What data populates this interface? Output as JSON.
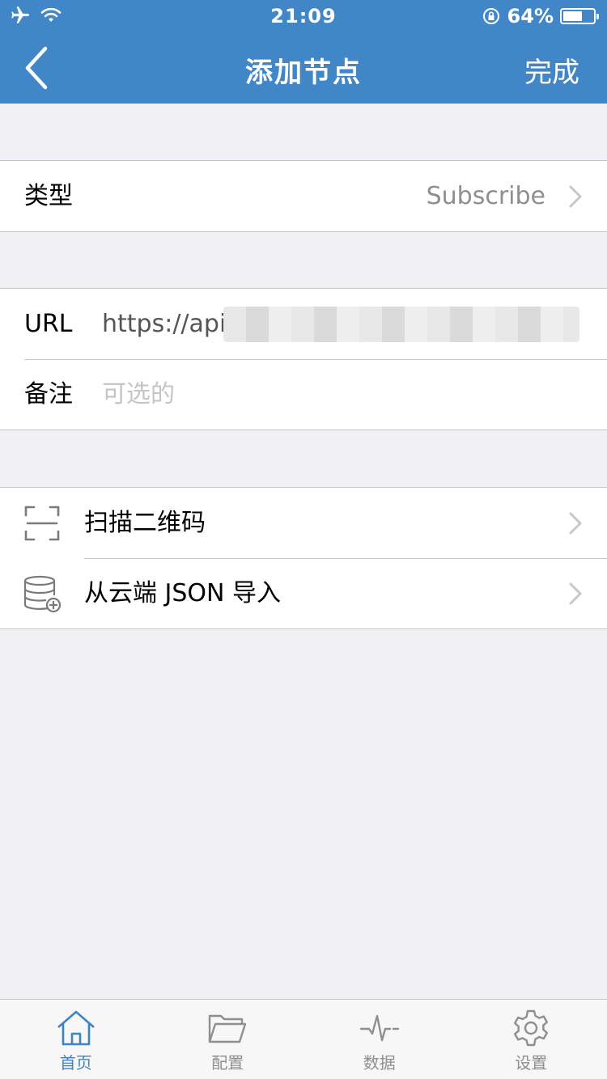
{
  "status": {
    "time": "21:09",
    "battery": "64%",
    "battery_level": 0.64
  },
  "nav": {
    "title": "添加节点",
    "done_label": "完成"
  },
  "section_type": {
    "label": "类型",
    "value": "Subscribe"
  },
  "section_fields": {
    "url_label": "URL",
    "url_value": "https://api",
    "note_label": "备注",
    "note_placeholder": "可选的"
  },
  "section_import": {
    "scan_label": "扫描二维码",
    "cloud_json_label": "从云端 JSON 导入"
  },
  "tabs": [
    {
      "label": "首页",
      "icon": "home-icon",
      "active": true
    },
    {
      "label": "配置",
      "icon": "folder-icon",
      "active": false
    },
    {
      "label": "数据",
      "icon": "activity-icon",
      "active": false
    },
    {
      "label": "设置",
      "icon": "gear-icon",
      "active": false
    }
  ],
  "colors": {
    "accent": "#4187c7",
    "background": "#efeff4",
    "tab_active": "#3d84c6"
  }
}
